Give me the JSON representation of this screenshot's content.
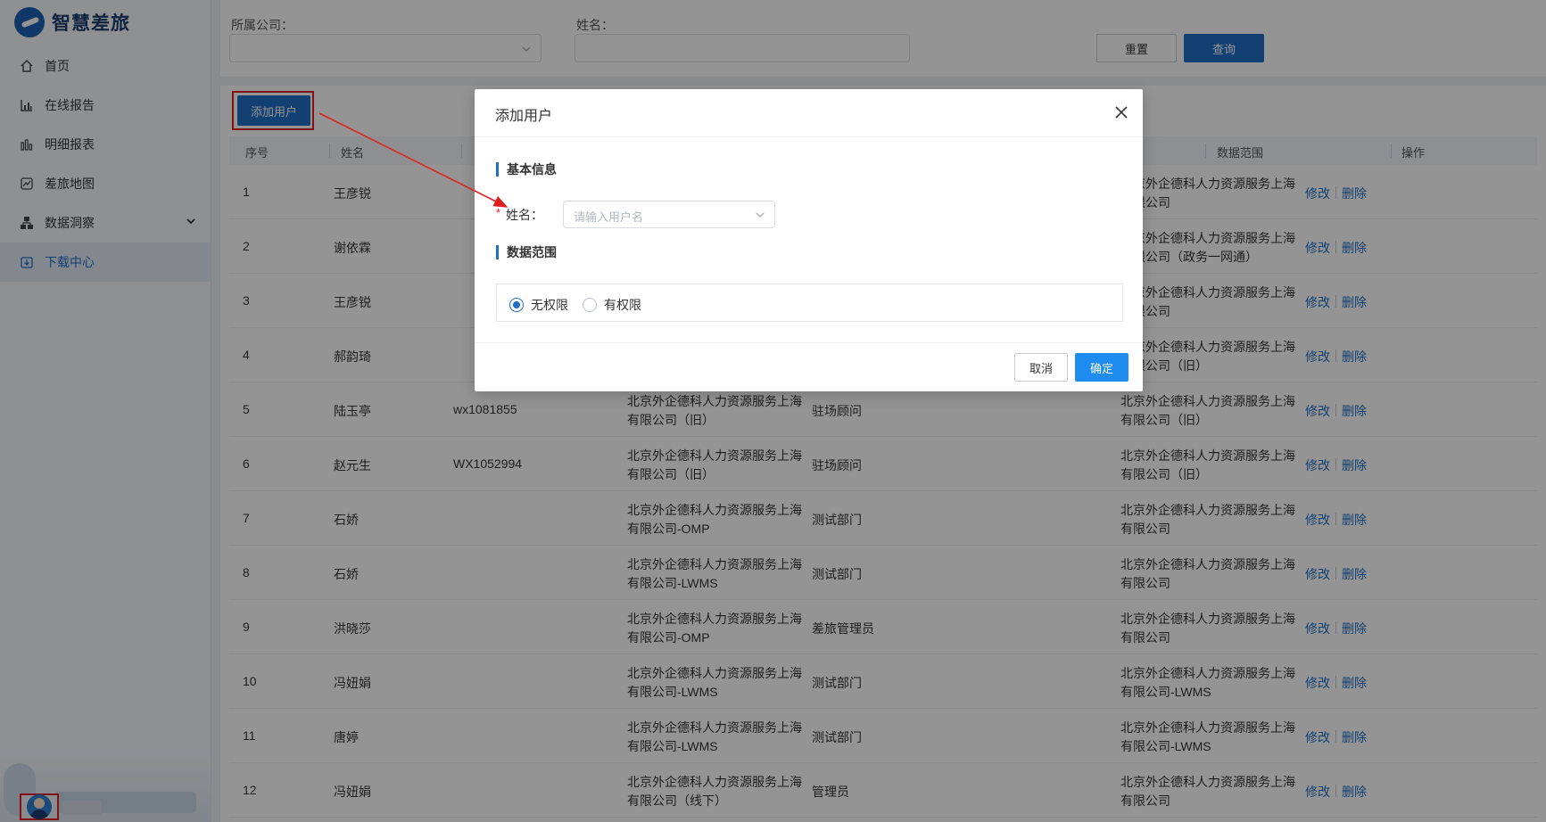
{
  "app": {
    "logo_text": "智慧差旅"
  },
  "sidebar": {
    "items": [
      {
        "label": "首页",
        "icon": "home-icon"
      },
      {
        "label": "在线报告",
        "icon": "bar-chart-icon"
      },
      {
        "label": "明细报表",
        "icon": "column-chart-icon"
      },
      {
        "label": "差旅地图",
        "icon": "map-chart-icon"
      },
      {
        "label": "数据洞察",
        "icon": "hierarchy-icon"
      },
      {
        "label": "下载中心",
        "icon": "download-box-icon"
      }
    ]
  },
  "filters": {
    "company_label": "所属公司：",
    "name_label": "姓名：",
    "reset_label": "重置",
    "query_label": "查询"
  },
  "toolbar": {
    "add_user_label": "添加用户"
  },
  "table": {
    "headers": [
      "序号",
      "姓名",
      "数据范围",
      "操作"
    ],
    "rows": [
      {
        "index": "1",
        "name": "王彦锐",
        "account": "",
        "company": [
          "",
          ""
        ],
        "dept": "",
        "scope": [
          "北京外企德科人力资源服务上海",
          "有限公司"
        ]
      },
      {
        "index": "2",
        "name": "谢依霖",
        "account": "",
        "company": [
          "",
          ""
        ],
        "dept": "",
        "scope": [
          "北京外企德科人力资源服务上海",
          "有限公司（政务一网通）"
        ]
      },
      {
        "index": "3",
        "name": "王彦锐",
        "account": "",
        "company": [
          "",
          ""
        ],
        "dept": "",
        "scope": [
          "北京外企德科人力资源服务上海",
          "有限公司"
        ]
      },
      {
        "index": "4",
        "name": "郝韵琦",
        "account": "",
        "company": [
          "",
          ""
        ],
        "dept": "",
        "scope": [
          "北京外企德科人力资源服务上海",
          "有限公司（旧）"
        ]
      },
      {
        "index": "5",
        "name": "陆玉亭",
        "account": "wx1081855",
        "company": [
          "北京外企德科人力资源服务上海",
          "有限公司（旧）"
        ],
        "dept": "驻场顾问",
        "scope": [
          "北京外企德科人力资源服务上海",
          "有限公司（旧）"
        ]
      },
      {
        "index": "6",
        "name": "赵元生",
        "account": "WX1052994",
        "company": [
          "北京外企德科人力资源服务上海",
          "有限公司（旧）"
        ],
        "dept": "驻场顾问",
        "scope": [
          "北京外企德科人力资源服务上海",
          "有限公司（旧）"
        ]
      },
      {
        "index": "7",
        "name": "石娇",
        "account": "",
        "company": [
          "北京外企德科人力资源服务上海",
          "有限公司-OMP"
        ],
        "dept": "测试部门",
        "scope": [
          "北京外企德科人力资源服务上海",
          "有限公司"
        ]
      },
      {
        "index": "8",
        "name": "石娇",
        "account": "",
        "company": [
          "北京外企德科人力资源服务上海",
          "有限公司-LWMS"
        ],
        "dept": "测试部门",
        "scope": [
          "北京外企德科人力资源服务上海",
          "有限公司"
        ]
      },
      {
        "index": "9",
        "name": "洪晓莎",
        "account": "",
        "company": [
          "北京外企德科人力资源服务上海",
          "有限公司-OMP"
        ],
        "dept": "差旅管理员",
        "scope": [
          "北京外企德科人力资源服务上海",
          "有限公司"
        ]
      },
      {
        "index": "10",
        "name": "冯妞娟",
        "account": "",
        "company": [
          "北京外企德科人力资源服务上海",
          "有限公司-LWMS"
        ],
        "dept": "测试部门",
        "scope": [
          "北京外企德科人力资源服务上海",
          "有限公司-LWMS"
        ]
      },
      {
        "index": "11",
        "name": "唐婷",
        "account": "",
        "company": [
          "北京外企德科人力资源服务上海",
          "有限公司-LWMS"
        ],
        "dept": "测试部门",
        "scope": [
          "北京外企德科人力资源服务上海",
          "有限公司-LWMS"
        ]
      },
      {
        "index": "12",
        "name": "冯妞娟",
        "account": "",
        "company": [
          "北京外企德科人力资源服务上海",
          "有限公司（线下）"
        ],
        "dept": "管理员",
        "scope": [
          "北京外企德科人力资源服务上海",
          "有限公司"
        ]
      }
    ],
    "edit_label": "修改",
    "delete_label": "删除"
  },
  "dialog": {
    "title": "添加用户",
    "section_basic": "基本信息",
    "required_mark": "*",
    "name_label": "姓名：",
    "name_placeholder": "请输入用户名",
    "section_scope": "数据范围",
    "radio_none": "无权限",
    "radio_has": "有权限",
    "selected": "无权限",
    "cancel_label": "取消",
    "ok_label": "确定"
  },
  "colors": {
    "primary": "#1f6fc5",
    "highlight": "#e02020"
  }
}
